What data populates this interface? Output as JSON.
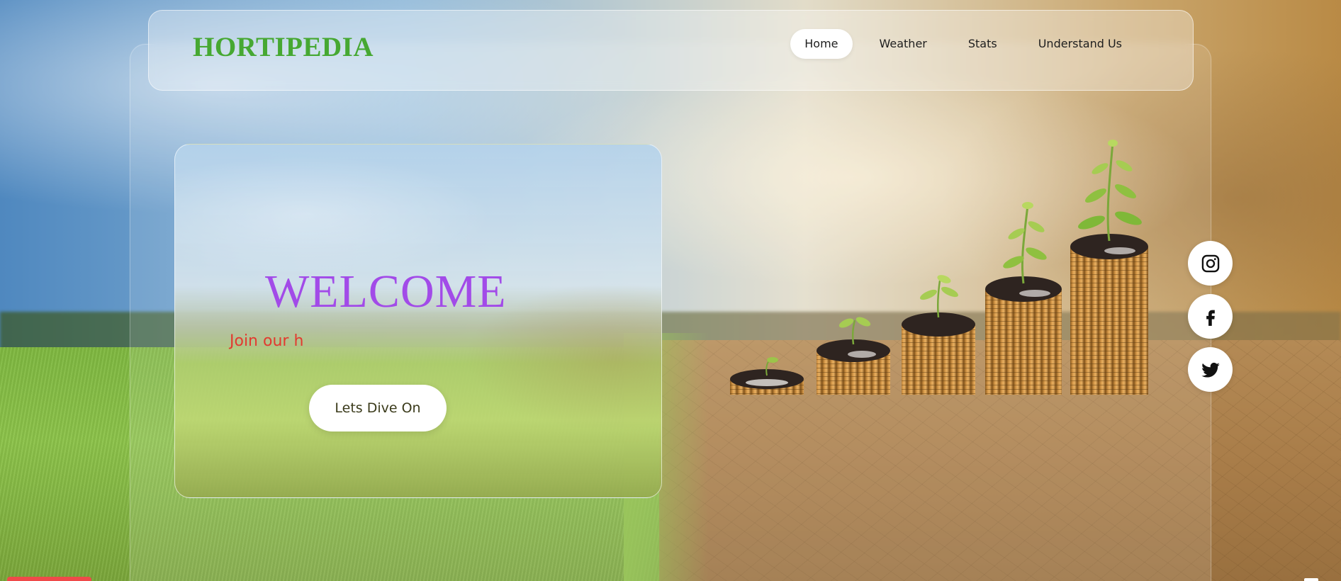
{
  "header": {
    "logo": "HORTIPEDIA",
    "nav": [
      {
        "label": "Home",
        "active": true
      },
      {
        "label": "Weather",
        "active": false
      },
      {
        "label": "Stats",
        "active": false
      },
      {
        "label": "Understand Us",
        "active": false
      }
    ]
  },
  "hero": {
    "title": "WELCOME",
    "subtitle": "Join our h",
    "cta_label": "Lets Dive On"
  },
  "social": [
    {
      "icon": "instagram-icon"
    },
    {
      "icon": "facebook-icon"
    },
    {
      "icon": "twitter-icon"
    }
  ],
  "colors": {
    "logo": "#46a832",
    "title": "#a24be8",
    "subtitle": "#e23a2f",
    "button_bg": "#ffffff"
  }
}
